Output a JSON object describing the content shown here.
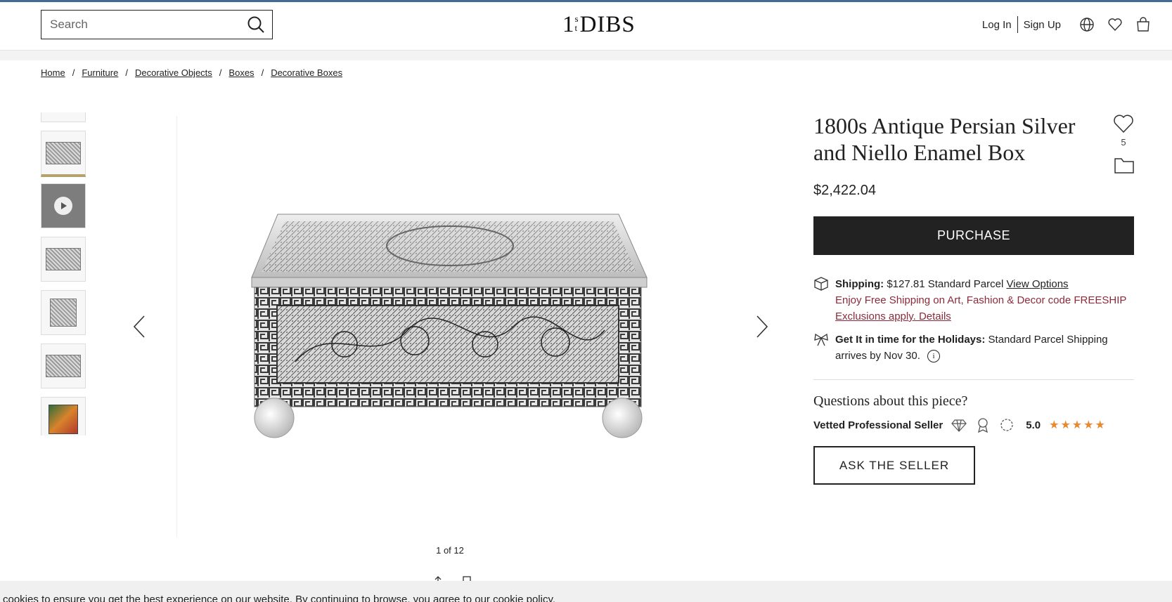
{
  "header": {
    "search_placeholder": "Search",
    "logo_one": "1",
    "logo_s": "s",
    "logo_t": "t",
    "logo_dibs": "DIBS",
    "login": "Log In",
    "signup": "Sign Up"
  },
  "breadcrumb": {
    "items": [
      "Home",
      "Furniture",
      "Decorative Objects",
      "Boxes",
      "Decorative Boxes"
    ],
    "separator": "/"
  },
  "gallery": {
    "counter": "1 of 12"
  },
  "product": {
    "title": "1800s Antique Persian Silver and Niello Enamel Box",
    "favorites_count": "5",
    "price": "$2,422.04",
    "purchase_label": "PURCHASE",
    "shipping_label": "Shipping:",
    "shipping_value": "$127.81 Standard Parcel",
    "view_options": "View Options",
    "promo_text": "Enjoy Free Shipping on Art, Fashion & Decor code FREESHIP",
    "exclusions": "Exclusions apply. Details",
    "holiday_label": "Get It in time for the Holidays:",
    "holiday_text": "Standard Parcel Shipping arrives by Nov 30.",
    "questions": "Questions about this piece?",
    "seller_label": "Vetted Professional Seller",
    "rating": "5.0",
    "stars": "★★★★★",
    "ask_label": "ASK THE SELLER"
  },
  "cookie": {
    "text": "cookies to ensure you get the best experience on our website. By continuing to browse, you agree to our cookie policy."
  },
  "colors": {
    "accent_dark": "#222222",
    "promo": "#8b2a3a",
    "star": "#e8892f",
    "active_thumb": "#b3a26a"
  }
}
